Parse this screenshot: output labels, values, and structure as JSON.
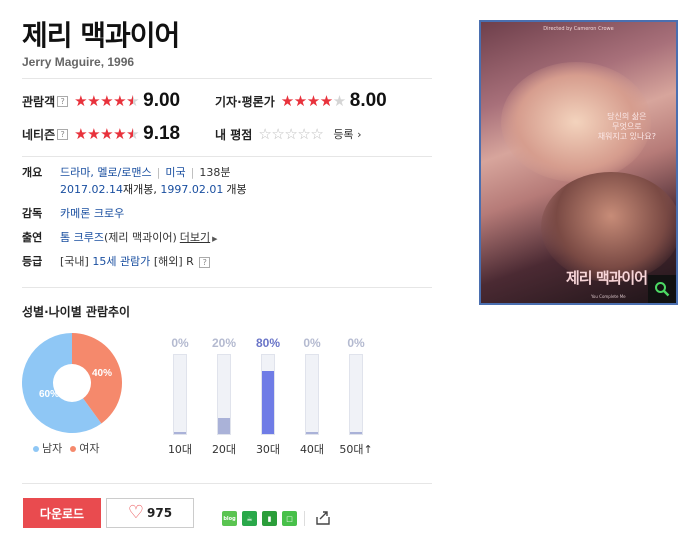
{
  "movie": {
    "title": "제리 맥과이어",
    "subtitle": "Jerry Maguire, 1996"
  },
  "ratings": {
    "audience": {
      "label": "관람객",
      "help": "?",
      "score": "9.00",
      "stars": 4.5
    },
    "critic": {
      "label": "기자·평론가",
      "score": "8.00",
      "stars": 4
    },
    "netizen": {
      "label": "네티즌",
      "help": "?",
      "score": "9.18",
      "stars": 4.5
    },
    "mine": {
      "label": "내 평점",
      "register": "등록",
      "stars": 0
    }
  },
  "info": {
    "overview_label": "개요",
    "genre": "드라마, 멜로/로맨스",
    "country": "미국",
    "runtime": "138분",
    "release_2017": "2017.02.14",
    "rerelease_word": "재개봉",
    "release_1997": "1997.02.01",
    "release_word": "개봉",
    "director_label": "감독",
    "director": "카메론 크로우",
    "cast_label": "출연",
    "cast_name": "톰 크루즈",
    "cast_role": "(제리 맥과이어)",
    "more": "더보기",
    "grade_label": "등급",
    "grade_prefix": "[국내]",
    "grade": "15세 관람가",
    "grade_overseas": "[해외] R",
    "help": "?"
  },
  "trend": {
    "title": "성별·나이별 관람추이",
    "male_label": "남자",
    "female_label": "여자",
    "male_pct": 60,
    "female_pct": 40,
    "male_text": "60%",
    "female_text": "40%",
    "colors": {
      "male": "#8fc7f5",
      "female": "#f5896c"
    },
    "ages": [
      {
        "label": "10대",
        "pct_text": "0%",
        "value": 0
      },
      {
        "label": "20대",
        "pct_text": "20%",
        "value": 20
      },
      {
        "label": "30대",
        "pct_text": "80%",
        "value": 80
      },
      {
        "label": "40대",
        "pct_text": "0%",
        "value": 0
      },
      {
        "label": "50대↑",
        "pct_text": "0%",
        "value": 0
      }
    ]
  },
  "actions": {
    "download": "다운로드",
    "like_count": "975",
    "share_blog": "blog"
  },
  "poster": {
    "credit": "Directed by Cameron Crowe",
    "tagline_1": "당신의 삶은",
    "tagline_2": "무엇으로",
    "tagline_3": "채워지고 있나요?",
    "title": "제리 맥과이어",
    "quote": "You Complete Me"
  }
}
